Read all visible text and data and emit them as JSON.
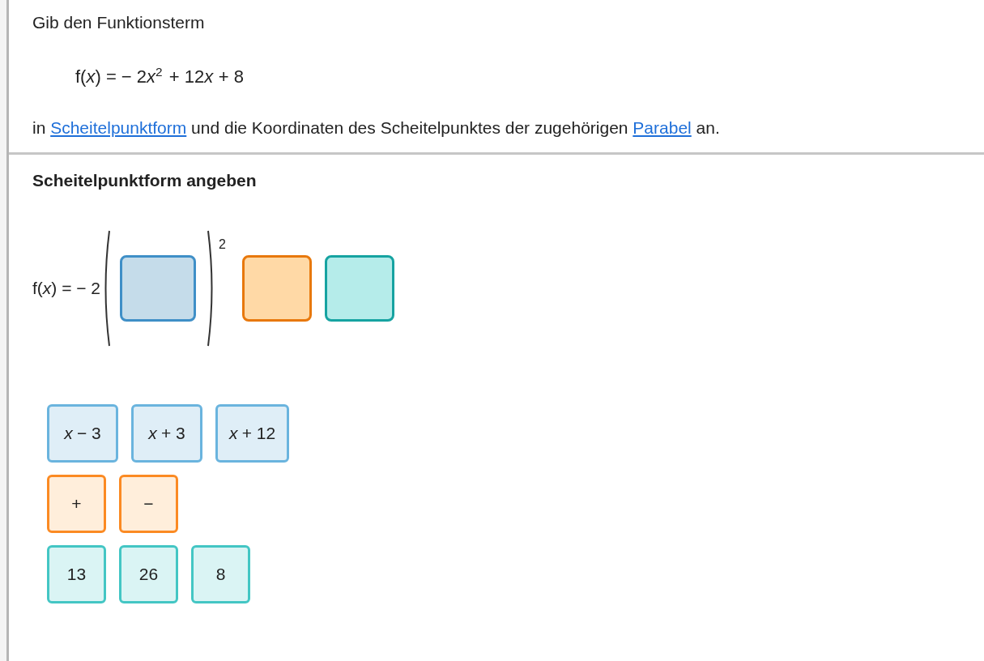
{
  "task": {
    "intro": "Gib den Funktionsterm",
    "formula": [
      {
        "kind": "text",
        "text": "f("
      },
      {
        "kind": "var",
        "text": "x"
      },
      {
        "kind": "text",
        "text": ") = − 2"
      },
      {
        "kind": "var",
        "text": "x"
      },
      {
        "kind": "sup",
        "text": "2"
      },
      {
        "kind": "spaced",
        "text": "+ 12"
      },
      {
        "kind": "var",
        "text": "x"
      },
      {
        "kind": "spaced",
        "text": "+ 8"
      }
    ],
    "sentence": [
      {
        "kind": "text",
        "text": "in "
      },
      {
        "kind": "link",
        "text": "Scheitelpunktform"
      },
      {
        "kind": "text",
        "text": " und die Koordinaten des Scheitelpunktes der zugehörigen "
      },
      {
        "kind": "link",
        "text": "Parabel"
      },
      {
        "kind": "text",
        "text": " an."
      }
    ]
  },
  "exercise": {
    "heading": "Scheitelpunktform angeben",
    "equation": {
      "prefix": [
        {
          "kind": "text",
          "text": "f("
        },
        {
          "kind": "var",
          "text": "x"
        },
        {
          "kind": "text",
          "text": ") = − 2"
        }
      ],
      "exponent": "2",
      "slots": [
        {
          "kind": "term"
        },
        {
          "kind": "operator"
        },
        {
          "kind": "number"
        }
      ]
    },
    "tile_groups": [
      {
        "kind": "term",
        "tiles": [
          {
            "var": "x",
            "text": "− 3"
          },
          {
            "var": "x",
            "text": "+ 3"
          },
          {
            "var": "x",
            "text": "+ 12"
          }
        ]
      },
      {
        "kind": "operator",
        "tiles": [
          {
            "text": "+"
          },
          {
            "text": "−"
          }
        ]
      },
      {
        "kind": "number",
        "tiles": [
          {
            "text": "13"
          },
          {
            "text": "26"
          },
          {
            "text": "8"
          }
        ]
      }
    ]
  }
}
